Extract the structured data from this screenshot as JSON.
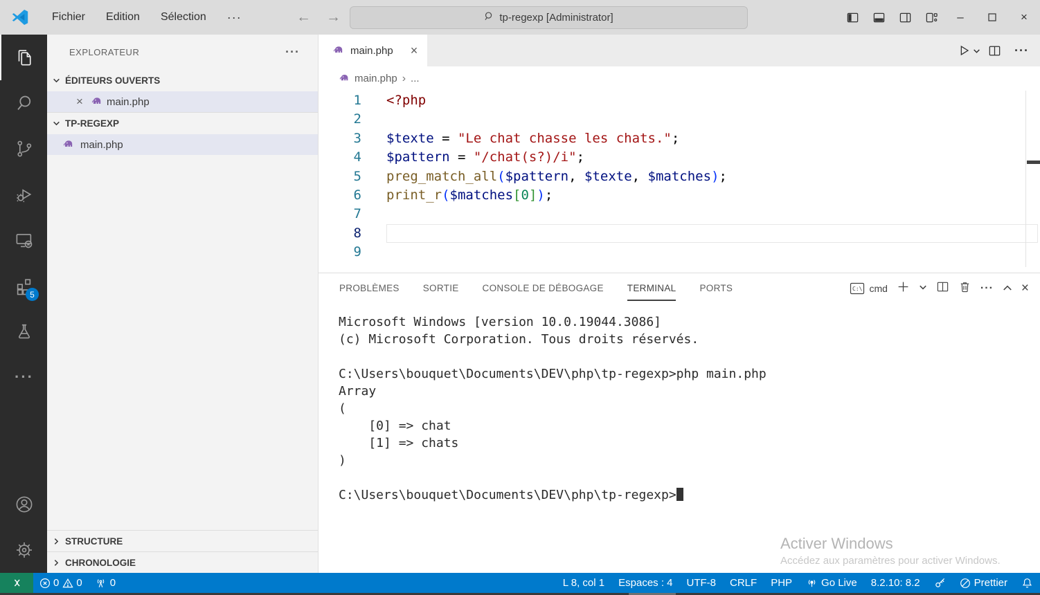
{
  "title_bar": {
    "menus": [
      "Fichier",
      "Edition",
      "Sélection",
      "···"
    ],
    "search": "tp-regexp [Administrator]"
  },
  "activity_bar": {
    "extensions_badge": "5"
  },
  "sidebar": {
    "title": "EXPLORATEUR",
    "open_editors_label": "ÉDITEURS OUVERTS",
    "open_editors": [
      {
        "name": "main.php"
      }
    ],
    "folder_label": "TP-REGEXP",
    "files": [
      {
        "name": "main.php"
      }
    ],
    "bottom_sections": [
      "STRUCTURE",
      "CHRONOLOGIE"
    ]
  },
  "editor": {
    "tab": "main.php",
    "breadcrumb": [
      "main.php",
      "..."
    ],
    "current_line": 8,
    "code_lines": [
      [
        [
          "php",
          "<?php"
        ]
      ],
      [],
      [
        [
          "var",
          "$texte"
        ],
        [
          "op",
          " = "
        ],
        [
          "str",
          "\"Le chat chasse les chats.\""
        ],
        [
          "pun",
          ";"
        ]
      ],
      [
        [
          "var",
          "$pattern"
        ],
        [
          "op",
          " = "
        ],
        [
          "str",
          "\"/chat(s?)/i\""
        ],
        [
          "pun",
          ";"
        ]
      ],
      [
        [
          "fn",
          "preg_match_all"
        ],
        [
          "b1",
          "("
        ],
        [
          "var",
          "$pattern"
        ],
        [
          "pun",
          ", "
        ],
        [
          "var",
          "$texte"
        ],
        [
          "pun",
          ", "
        ],
        [
          "var",
          "$matches"
        ],
        [
          "b1",
          ")"
        ],
        [
          "pun",
          ";"
        ]
      ],
      [
        [
          "fn",
          "print_r"
        ],
        [
          "b1",
          "("
        ],
        [
          "var",
          "$matches"
        ],
        [
          "b2",
          "["
        ],
        [
          "num",
          "0"
        ],
        [
          "b2",
          "]"
        ],
        [
          "b1",
          ")"
        ],
        [
          "pun",
          ";"
        ]
      ],
      [],
      [],
      []
    ]
  },
  "panel": {
    "tabs": [
      "PROBLÈMES",
      "SORTIE",
      "CONSOLE DE DÉBOGAGE",
      "TERMINAL",
      "PORTS"
    ],
    "active_tab": "TERMINAL",
    "shell_label": "cmd",
    "terminal_lines": [
      "Microsoft Windows [version 10.0.19044.3086]",
      "(c) Microsoft Corporation. Tous droits réservés.",
      "",
      "C:\\Users\\bouquet\\Documents\\DEV\\php\\tp-regexp>php main.php",
      "Array",
      "(",
      "    [0] => chat",
      "    [1] => chats",
      ")",
      "",
      "C:\\Users\\bouquet\\Documents\\DEV\\php\\tp-regexp>"
    ]
  },
  "status_bar": {
    "errors": "0",
    "warnings": "0",
    "ports": "0",
    "cursor_position": "L 8, col 1",
    "indentation": "Espaces : 4",
    "encoding": "UTF-8",
    "eol": "CRLF",
    "language": "PHP",
    "go_live": "Go Live",
    "php_version": "8.2.10: 8.2",
    "prettier": "Prettier"
  },
  "watermark": {
    "line1": "Activer Windows",
    "line2": "Accédez aux paramètres pour activer Windows."
  },
  "colors": {
    "accent": "#007acc",
    "activity_bar": "#2c2c2c",
    "remote_green": "#16825d",
    "selection": "#e4e6f1",
    "php_icon": "#8a63b3"
  }
}
